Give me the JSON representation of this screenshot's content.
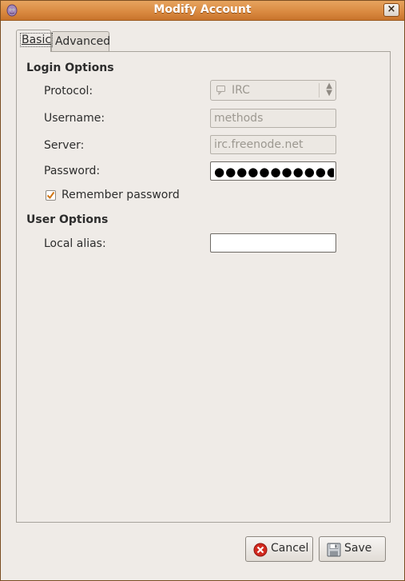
{
  "window": {
    "title": "Modify Account",
    "close_glyph": "×"
  },
  "tabs": [
    {
      "label": "Basic",
      "active": true
    },
    {
      "label": "Advanced",
      "active": false
    }
  ],
  "login_options": {
    "title": "Login Options",
    "protocol": {
      "label": "Protocol:",
      "value": "IRC",
      "icon": "chat-icon"
    },
    "username": {
      "label": "Username:",
      "value": "methods"
    },
    "server": {
      "label": "Server:",
      "value": "irc.freenode.net"
    },
    "password": {
      "label": "Password:",
      "value": "●●●●●●●●●●●●●●●"
    },
    "remember": {
      "label": "Remember password",
      "checked": true
    }
  },
  "user_options": {
    "title": "User Options",
    "local_alias": {
      "label": "Local alias:",
      "value": ""
    }
  },
  "buttons": {
    "cancel": {
      "label": "Cancel",
      "icon": "cancel-icon"
    },
    "save": {
      "label": "Save",
      "icon": "floppy-icon"
    }
  },
  "colors": {
    "titlebar": "#d9883f",
    "check": "#d07515",
    "cancel_red": "#d22a1f"
  }
}
